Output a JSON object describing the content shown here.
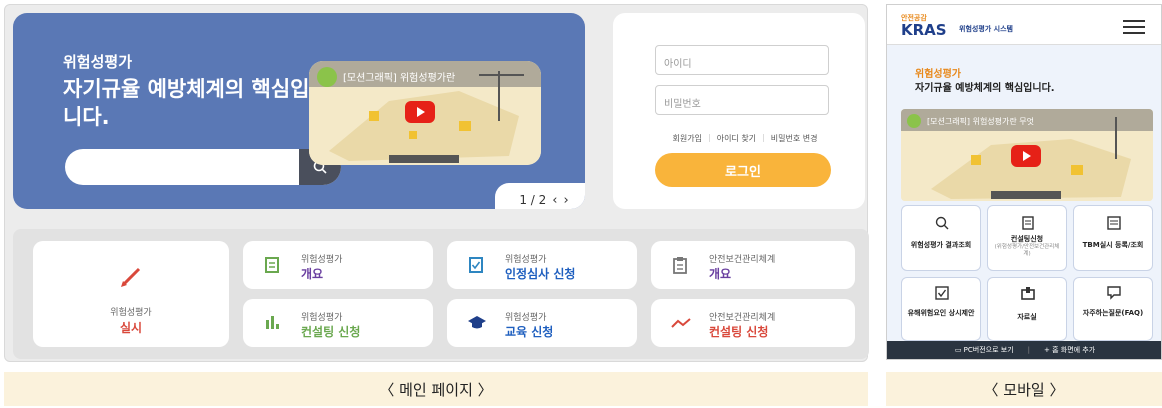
{
  "hero": {
    "subtitle": "위험성평가",
    "title": "자기규율 예방체계의 핵심입니다.",
    "search_placeholder": ""
  },
  "video": {
    "title": "[모션그래픽] 위험성평가란"
  },
  "pager": {
    "label": "1 / 2"
  },
  "login": {
    "id_placeholder": "아이디",
    "pw_placeholder": "비밀번호",
    "link_join": "회원가입",
    "link_find_id": "아이디 찾기",
    "link_change_pw": "비밀번호 변경",
    "button": "로그인"
  },
  "menu": {
    "main": {
      "line1": "위험성평가",
      "line2": "실시"
    },
    "items": [
      {
        "line1": "위험성평가",
        "line2": "개요"
      },
      {
        "line1": "위험성평가",
        "line2": "인정심사 신청"
      },
      {
        "line1": "안전보건관리체계",
        "line2": "개요"
      },
      {
        "line1": "위험성평가",
        "line2": "컨설팅 신청"
      },
      {
        "line1": "위험성평가",
        "line2": "교육 신청"
      },
      {
        "line1": "안전보건관리체계",
        "line2": "컨설팅 신청"
      }
    ]
  },
  "captions": {
    "main": "〈 메인 페이지 〉",
    "mobile": "〈 모바일 〉"
  },
  "mobile": {
    "logo_small": "안전공감",
    "logo": "KRAS",
    "logo_text": "위험성평가 시스템",
    "sub": "위험성평가",
    "title": "자기규율 예방체계의 핵심입니다.",
    "video_title": "[모션그래픽] 위험성평가란 무엇",
    "grid": [
      {
        "title": "위험성평가 결과조회",
        "sub": ""
      },
      {
        "title": "컨설팅신청",
        "sub": "(위험성평가/안전보건관리체계)"
      },
      {
        "title": "TBM실시 등록/조회",
        "sub": ""
      },
      {
        "title": "유해위험요인 상시제안",
        "sub": ""
      },
      {
        "title": "자료실",
        "sub": ""
      },
      {
        "title": "자주하는질문(FAQ)",
        "sub": ""
      }
    ],
    "footer_pc": "PC버전으로 보기",
    "footer_home": "홈 화면에 추가"
  },
  "colors": {
    "hero_bg": "#5a78b5",
    "accent_orange": "#f9b43b",
    "text_red": "#d9483b",
    "text_blue": "#1f5fbf",
    "text_purple": "#6a3fa0"
  }
}
